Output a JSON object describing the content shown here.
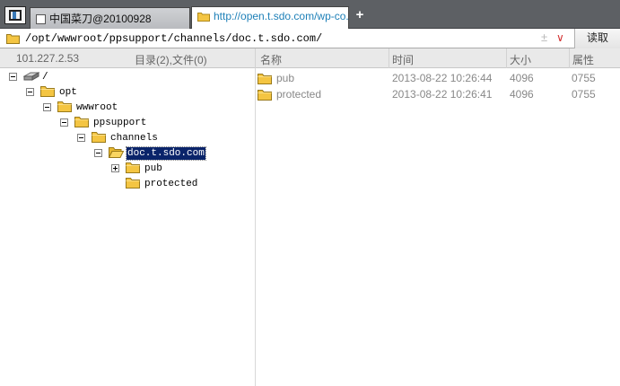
{
  "tabs": [
    {
      "label": "中国菜刀@20100928"
    },
    {
      "label": "http://open.t.sdo.com/wp-co..."
    }
  ],
  "new_tab": "+",
  "address": {
    "path": "/opt/wwwroot/ppsupport/channels/doc.t.sdo.com/",
    "up_arrow": "±",
    "dropdown": "∨",
    "read_button": "读取"
  },
  "header": {
    "ip": "101.227.2.53",
    "counts": "目录(2),文件(0)",
    "col_name": "名称",
    "col_time": "时间",
    "col_size": "大小",
    "col_attr": "属性"
  },
  "tree": [
    {
      "label": "/"
    },
    {
      "label": "opt"
    },
    {
      "label": "wwwroot"
    },
    {
      "label": "ppsupport"
    },
    {
      "label": "channels"
    },
    {
      "label": "doc.t.sdo.com"
    },
    {
      "label": "pub"
    },
    {
      "label": "protected"
    }
  ],
  "files": [
    {
      "name": "pub",
      "time": "2013-08-22 10:26:44",
      "size": "4096",
      "attr": "0755"
    },
    {
      "name": "protected",
      "time": "2013-08-22 10:26:41",
      "size": "4096",
      "attr": "0755"
    }
  ],
  "colors": {
    "tab_active_text": "#1e80b8",
    "selection": "#0a246a",
    "folder": "#f4c542",
    "tabbar": "#5d6064"
  }
}
